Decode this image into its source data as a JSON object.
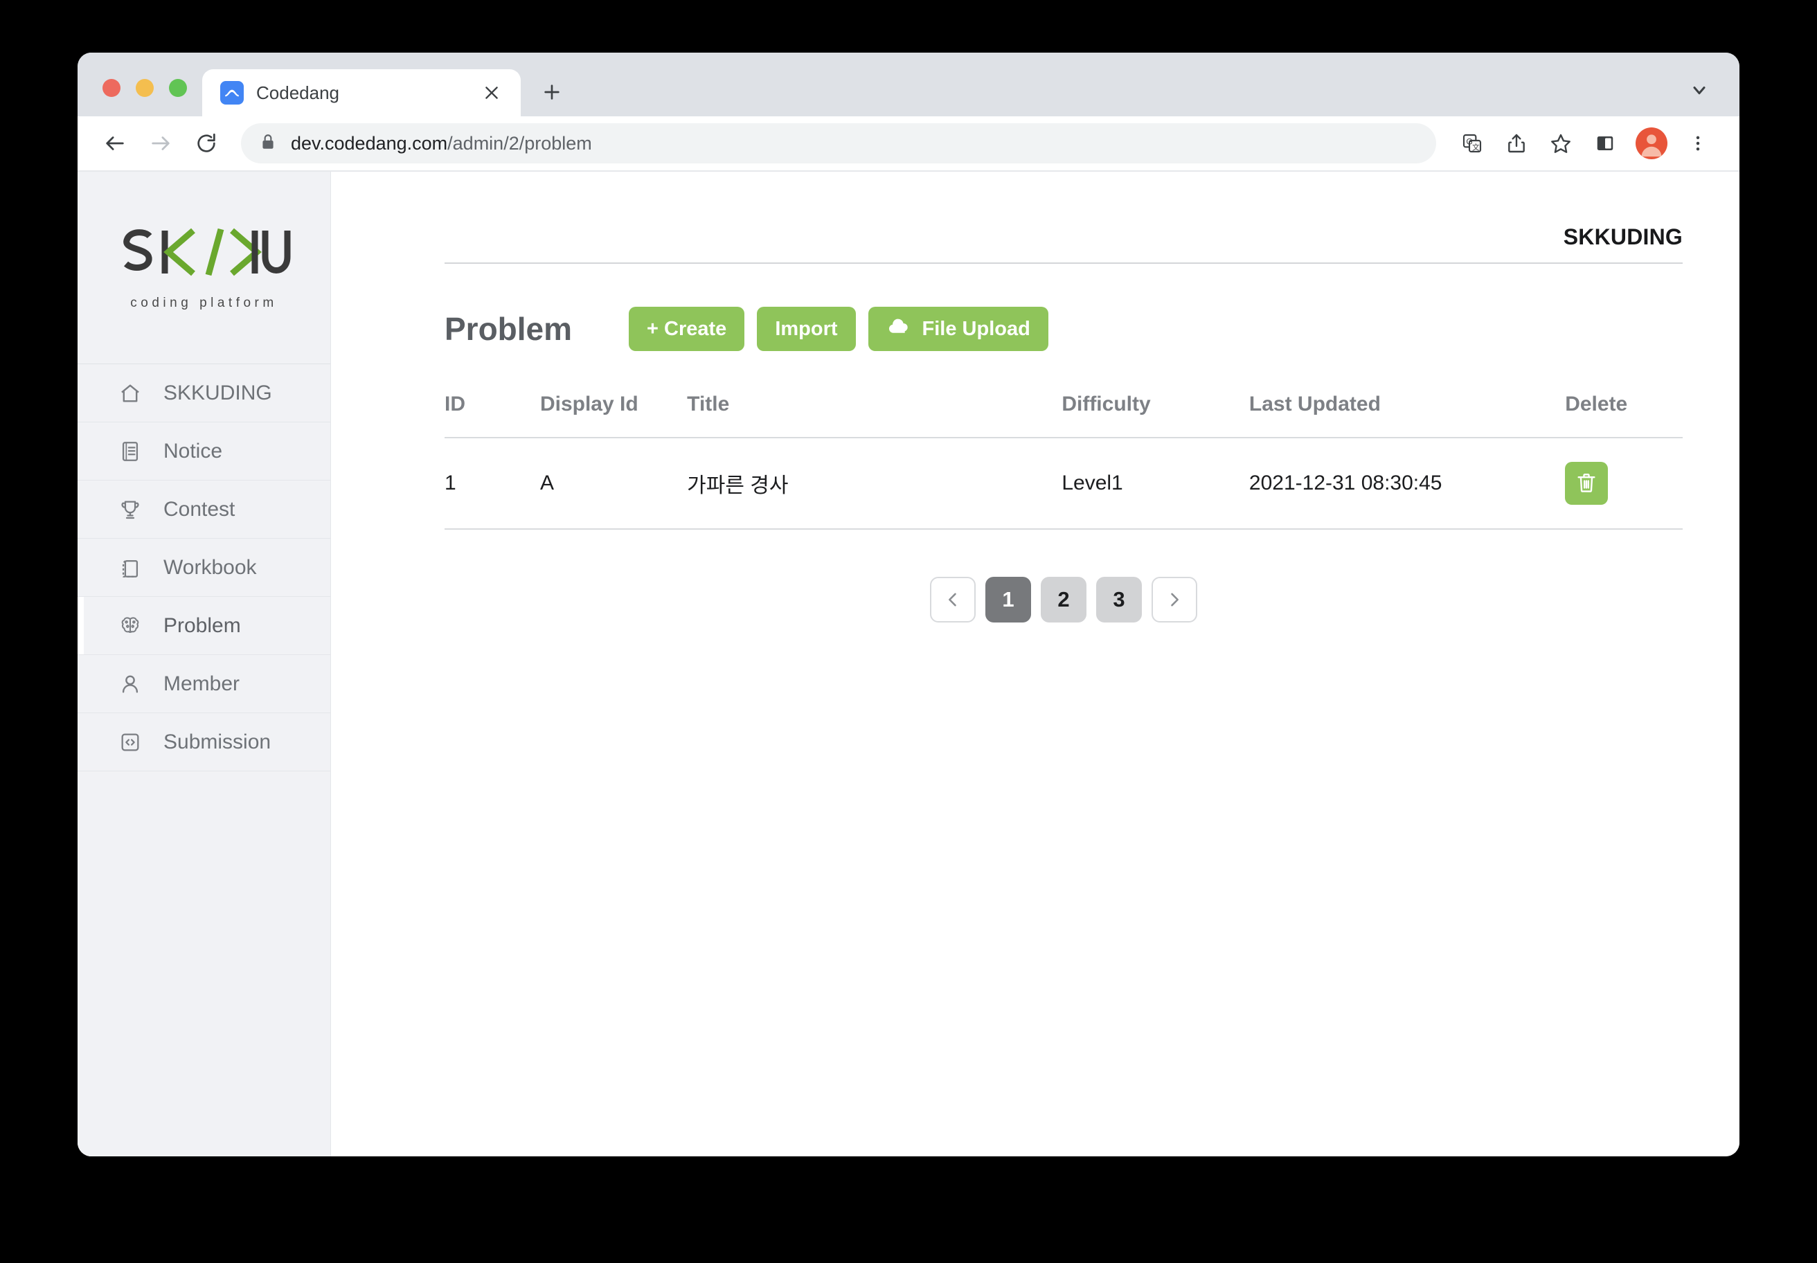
{
  "browser": {
    "tab": {
      "title": "Codedang",
      "favicon": "codedang-favicon",
      "close": "×"
    },
    "new_tab_label": "+",
    "url": {
      "domain": "dev.codedang.com",
      "path": "/admin/2/problem"
    },
    "toolbar_icons": [
      "back-icon",
      "forward-icon",
      "reload-icon",
      "lock-icon",
      "translate-icon",
      "share-icon",
      "bookmark-star-icon",
      "side-panel-icon",
      "avatar",
      "kebab-menu-icon"
    ]
  },
  "sidebar": {
    "logo": {
      "text_dark_1": "SK",
      "text_green": "/",
      "text_dark_2": "U",
      "subtitle": "coding platform",
      "green": "#6AA82E",
      "dark": "#3A3A3A"
    },
    "items": [
      {
        "label": "SKKUDING",
        "icon": "home-icon",
        "active": false
      },
      {
        "label": "Notice",
        "icon": "document-icon",
        "active": false
      },
      {
        "label": "Contest",
        "icon": "trophy-icon",
        "active": false
      },
      {
        "label": "Workbook",
        "icon": "book-icon",
        "active": false
      },
      {
        "label": "Problem",
        "icon": "brain-icon",
        "active": true
      },
      {
        "label": "Member",
        "icon": "person-icon",
        "active": false
      },
      {
        "label": "Submission",
        "icon": "code-brackets-icon",
        "active": false
      }
    ]
  },
  "main": {
    "breadcrumb": "SKKUDING",
    "title": "Problem",
    "buttons": [
      {
        "label": "+ Create",
        "icon": null
      },
      {
        "label": "Import",
        "icon": null
      },
      {
        "label": "File Upload",
        "icon": "cloud-download-icon"
      }
    ],
    "accent_green": "#8FC45A",
    "table": {
      "headers": [
        "ID",
        "Display Id",
        "Title",
        "Difficulty",
        "Last Updated",
        "Delete"
      ],
      "rows": [
        {
          "id": "1",
          "display_id": "A",
          "title": "가파른 경사",
          "difficulty": "Level1",
          "last_updated": "2021-12-31 08:30:45",
          "delete_icon": "trash-icon"
        }
      ]
    },
    "pagination": {
      "prev": "‹",
      "next": "›",
      "pages": [
        "1",
        "2",
        "3"
      ],
      "current": "1"
    }
  }
}
